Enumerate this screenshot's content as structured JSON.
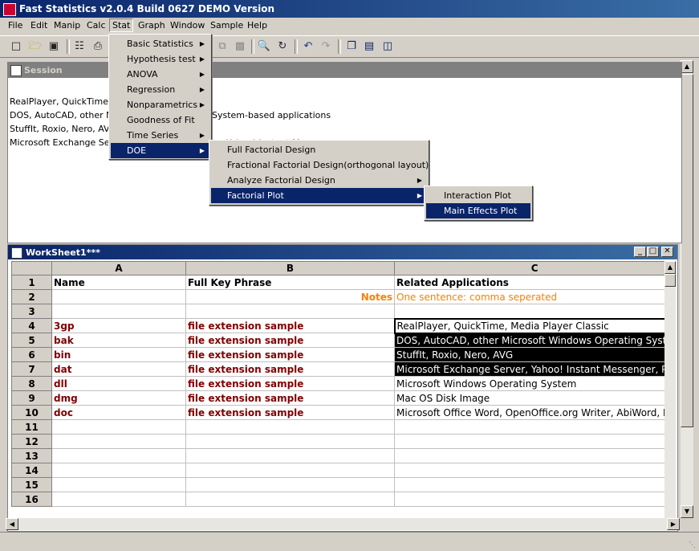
{
  "app": {
    "title": "Fast Statistics v2.0.4 Build 0627 DEMO Version"
  },
  "menubar": [
    "File",
    "Edit",
    "Manip",
    "Calc",
    "Stat",
    "Graph",
    "Window",
    "Sample",
    "Help"
  ],
  "toolbar": {
    "icons": [
      "new-file-icon",
      "open-folder-icon",
      "save-icon",
      "properties-icon",
      "print-icon",
      "cut-icon",
      "copy-icon",
      "paste-icon",
      "find-icon",
      "replace-icon",
      "undo-icon",
      "redo-icon",
      "cascade-icon",
      "tile-horizontal-icon",
      "tile-vertical-icon"
    ]
  },
  "session": {
    "title": "Session",
    "lines": [
      "RealPlayer, QuickTime, M",
      "DOS, AutoCAD, other Mic",
      "StuffIt, Roxio, Nero, AVG",
      "Microsoft Exchange Serve"
    ],
    "fragments": {
      "system_based": "System-based applications",
      "partial": "Yahoo! Instant Messenger"
    }
  },
  "stat_menu": {
    "items": [
      {
        "label": "Basic Statistics",
        "submenu": true
      },
      {
        "label": "Hypothesis test",
        "submenu": true
      },
      {
        "label": "ANOVA",
        "submenu": true
      },
      {
        "label": "Regression",
        "submenu": true
      },
      {
        "label": "Nonparametrics",
        "submenu": true
      },
      {
        "label": "Goodness of Fit",
        "submenu": false
      },
      {
        "label": "Time Series",
        "submenu": true
      },
      {
        "label": "DOE",
        "submenu": true,
        "highlighted": true
      }
    ]
  },
  "doe_menu": {
    "items": [
      {
        "label": "Full Factorial Design",
        "submenu": false
      },
      {
        "label": "Fractional Factorial Design(orthogonal layout)",
        "submenu": false
      },
      {
        "label": "Analyze Factorial Design",
        "submenu": true
      },
      {
        "label": "Factorial Plot",
        "submenu": true,
        "highlighted": true
      }
    ]
  },
  "factorial_plot_menu": {
    "items": [
      {
        "label": "Interaction Plot",
        "highlighted": false
      },
      {
        "label": "Main Effects Plot",
        "highlighted": true
      }
    ]
  },
  "worksheet": {
    "title": "WorkSheet1***",
    "columns": [
      "A",
      "B",
      "C"
    ],
    "rows": [
      {
        "num": "1",
        "a": "Name",
        "b": "Full Key Phrase",
        "c": "Related Applications"
      },
      {
        "num": "2",
        "a": "",
        "b": "Notes",
        "c": "One sentence: comma seperated"
      },
      {
        "num": "3",
        "a": "",
        "b": "",
        "c": ""
      },
      {
        "num": "4",
        "a": "3gp",
        "b": "file extension sample",
        "c": "RealPlayer, QuickTime, Media Player Classic"
      },
      {
        "num": "5",
        "a": "bak",
        "b": "file extension sample",
        "c": "DOS, AutoCAD, other Microsoft Windows Operating Syst"
      },
      {
        "num": "6",
        "a": "bin",
        "b": "file extension sample",
        "c": "StuffIt, Roxio, Nero, AVG"
      },
      {
        "num": "7",
        "a": "dat",
        "b": "file extension sample",
        "c": "Microsoft Exchange Server, Yahoo! Instant Messenger, Po"
      },
      {
        "num": "8",
        "a": "dll",
        "b": "file extension sample",
        "c": "Microsoft Windows Operating System"
      },
      {
        "num": "9",
        "a": "dmg",
        "b": "file extension sample",
        "c": "Mac OS Disk Image"
      },
      {
        "num": "10",
        "a": "doc",
        "b": "file extension sample",
        "c": "Microsoft Office Word, OpenOffice.org Writer, AbiWord, K"
      },
      {
        "num": "11",
        "a": "",
        "b": "",
        "c": ""
      },
      {
        "num": "12",
        "a": "",
        "b": "",
        "c": ""
      },
      {
        "num": "13",
        "a": "",
        "b": "",
        "c": ""
      },
      {
        "num": "14",
        "a": "",
        "b": "",
        "c": ""
      },
      {
        "num": "15",
        "a": "",
        "b": "",
        "c": ""
      },
      {
        "num": "16",
        "a": "",
        "b": "",
        "c": ""
      }
    ]
  },
  "colors": {
    "title_active": "#0a246a",
    "menu_highlight": "#0a246a",
    "extension_text": "#800000",
    "notes_text": "#ff8000"
  }
}
